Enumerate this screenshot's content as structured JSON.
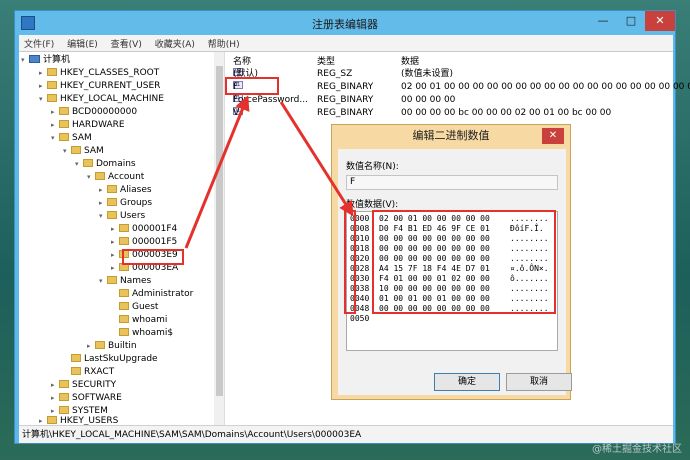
{
  "window": {
    "title": "注册表编辑器",
    "min_glyph": "—",
    "max_glyph": "□",
    "close_glyph": "✕"
  },
  "menu": [
    "文件(F)",
    "编辑(E)",
    "查看(V)",
    "收藏夹(A)",
    "帮助(H)"
  ],
  "tree": {
    "root": "计算机",
    "items": [
      {
        "label": "HKEY_CLASSES_ROOT",
        "expanded": false
      },
      {
        "label": "HKEY_CURRENT_USER",
        "expanded": false
      },
      {
        "label": "HKEY_LOCAL_MACHINE",
        "expanded": true
      },
      {
        "label": "BCD00000000",
        "expanded": false
      },
      {
        "label": "HARDWARE",
        "expanded": false
      },
      {
        "label": "SAM",
        "expanded": true
      },
      {
        "label": "SAM",
        "expanded": true
      },
      {
        "label": "Domains",
        "expanded": true
      },
      {
        "label": "Account",
        "expanded": true
      },
      {
        "label": "Aliases",
        "expanded": false
      },
      {
        "label": "Groups",
        "expanded": false
      },
      {
        "label": "Users",
        "expanded": true
      },
      {
        "label": "000001F4",
        "expanded": false
      },
      {
        "label": "000001F5",
        "expanded": false
      },
      {
        "label": "000003E9",
        "expanded": false
      },
      {
        "label": "000003EA",
        "expanded": false,
        "selected": true
      },
      {
        "label": "Names",
        "expanded": true
      },
      {
        "label": "Administrator",
        "expanded": false
      },
      {
        "label": "Guest",
        "expanded": false
      },
      {
        "label": "whoami",
        "expanded": false
      },
      {
        "label": "whoami$",
        "expanded": false
      },
      {
        "label": "Builtin",
        "expanded": false
      },
      {
        "label": "LastSkuUpgrade",
        "expanded": false
      },
      {
        "label": "RXACT",
        "expanded": false
      },
      {
        "label": "SECURITY",
        "expanded": false
      },
      {
        "label": "SOFTWARE",
        "expanded": false
      },
      {
        "label": "SYSTEM",
        "expanded": false
      },
      {
        "label": "HKEY_USERS",
        "expanded": false
      }
    ]
  },
  "list": {
    "columns": [
      "名称",
      "类型",
      "数据"
    ],
    "rows": [
      {
        "name": "(默认)",
        "type": "REG_SZ",
        "data": "(数值未设置)"
      },
      {
        "name": "F",
        "type": "REG_BINARY",
        "data": "02 00 01 00 00 00 00 00 00 00 00 00 00 00 00 00 00 00 00 00 0"
      },
      {
        "name": "ForcePassword...",
        "type": "REG_BINARY",
        "data": "00 00 00 00"
      },
      {
        "name": "V",
        "type": "REG_BINARY",
        "data": "00 00 00 00 bc 00 00 00 02 00 01 00 bc 00 00"
      }
    ]
  },
  "status": "计算机\\HKEY_LOCAL_MACHINE\\SAM\\SAM\\Domains\\Account\\Users\\000003EA",
  "dialog": {
    "title": "编辑二进制数值",
    "close_glyph": "✕",
    "name_label": "数值名称(N):",
    "name_value": "F",
    "data_label": "数值数据(V):",
    "hex_rows": [
      {
        "offset": "0000",
        "bytes": "02 00 01 00 00 00 00 00",
        "ascii": "........"
      },
      {
        "offset": "0008",
        "bytes": "D0 F4 B1 ED 46 9F CE 01",
        "ascii": "ÐôíF.Î."
      },
      {
        "offset": "0010",
        "bytes": "00 00 00 00 00 00 00 00",
        "ascii": "........"
      },
      {
        "offset": "0018",
        "bytes": "00 00 00 00 00 00 00 00",
        "ascii": "........"
      },
      {
        "offset": "0020",
        "bytes": "00 00 00 00 00 00 00 00",
        "ascii": "........"
      },
      {
        "offset": "0028",
        "bytes": "A4 15 7F 18 F4 4E D7 01",
        "ascii": "¤.ô.ÔN×."
      },
      {
        "offset": "0030",
        "bytes": "F4 01 00 00 01 02 00 00",
        "ascii": "ô......."
      },
      {
        "offset": "0038",
        "bytes": "10 00 00 00 00 00 00 00",
        "ascii": "........"
      },
      {
        "offset": "0040",
        "bytes": "01 00 01 00 01 00 00 00",
        "ascii": "........"
      },
      {
        "offset": "0048",
        "bytes": "00 00 00 00 00 00 00 00",
        "ascii": "........"
      },
      {
        "offset": "0050",
        "bytes": "",
        "ascii": ""
      }
    ],
    "ok_label": "确定",
    "cancel_label": "取消"
  },
  "watermark": "@稀土掘金技术社区",
  "colors": {
    "highlight": "#e5312c",
    "titlebar": "#63bbe9",
    "dialog_frame": "#f6d9a3"
  }
}
